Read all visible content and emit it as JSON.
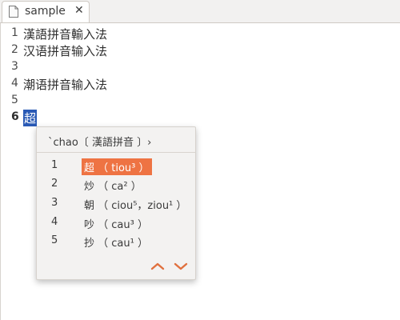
{
  "tab": {
    "title": "sample",
    "close_label": "✕"
  },
  "editor": {
    "lines": [
      {
        "number": "1",
        "text": "漢語拼音輸入法"
      },
      {
        "number": "2",
        "text": "汉语拼音输入法"
      },
      {
        "number": "3",
        "text": ""
      },
      {
        "number": "4",
        "text": "潮语拼音输入法"
      },
      {
        "number": "5",
        "text": ""
      },
      {
        "number": "6",
        "text": "超"
      }
    ],
    "current_line": "6"
  },
  "ime": {
    "preedit": "`chao〔 漢語拼音 〕›",
    "candidates": [
      {
        "index": "1",
        "text": "超 （ tiou³ ）"
      },
      {
        "index": "2",
        "text": "炒 （ ca² ）"
      },
      {
        "index": "3",
        "text": "朝 （ ciou⁵，ziou¹ ）"
      },
      {
        "index": "4",
        "text": "吵 （ cau³ ）"
      },
      {
        "index": "5",
        "text": "抄 （ cau¹ ）"
      }
    ],
    "highlighted_index": "1",
    "page_up_icon": "chevron-up-icon",
    "page_down_icon": "chevron-down-icon",
    "accent_color": "#ee7343",
    "selection_color": "#2a5ab5"
  }
}
